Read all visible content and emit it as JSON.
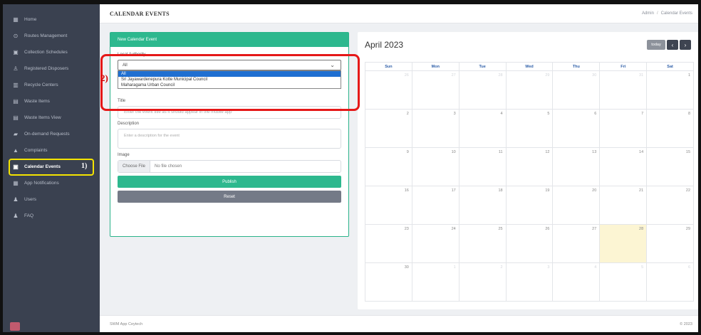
{
  "sidebar": {
    "items": [
      {
        "label": "Home",
        "icon": "grid-icon"
      },
      {
        "label": "Routes Management",
        "icon": "route-icon"
      },
      {
        "label": "Collection Schedules",
        "icon": "calendar-icon"
      },
      {
        "label": "Registered Disposers",
        "icon": "user-icon"
      },
      {
        "label": "Recycle Centers",
        "icon": "building-icon"
      },
      {
        "label": "Waste Items",
        "icon": "trash-icon"
      },
      {
        "label": "Waste Items View",
        "icon": "list-icon"
      },
      {
        "label": "On-demand Requests",
        "icon": "truck-icon"
      },
      {
        "label": "Complaints",
        "icon": "alert-icon"
      },
      {
        "label": "Calendar Events",
        "icon": "calendar-icon"
      },
      {
        "label": "App Notifications",
        "icon": "bell-icon"
      },
      {
        "label": "Users",
        "icon": "users-icon"
      },
      {
        "label": "FAQ",
        "icon": "question-icon"
      }
    ],
    "annotation_1": "1)"
  },
  "header": {
    "title": "CALENDAR EVENTS",
    "breadcrumb": [
      "Admin",
      "Calendar Events"
    ]
  },
  "form": {
    "header": "New Calendar Event",
    "authority_label": "Local Authority",
    "authority_value": "All",
    "authority_options": [
      "All",
      "Sri Jayawardenepura Kotte Municipal Council",
      "Maharagama Urban Council"
    ],
    "title_label": "Title",
    "title_placeholder": "Enter the event title as it should appear in the mobile app",
    "description_label": "Description",
    "description_placeholder": "Enter a description for the event",
    "image_label": "Image",
    "choose_file": "Choose File",
    "no_file": "No file chosen",
    "publish_label": "Publish",
    "reset_label": "Reset",
    "annotation_2": "2)"
  },
  "calendar": {
    "title": "April 2023",
    "today_label": "today",
    "prev_label": "‹",
    "next_label": "›",
    "days": [
      "Sun",
      "Mon",
      "Tue",
      "Wed",
      "Thu",
      "Fri",
      "Sat"
    ],
    "weeks": [
      [
        "26",
        "27",
        "28",
        "29",
        "30",
        "31",
        "1"
      ],
      [
        "2",
        "3",
        "4",
        "5",
        "6",
        "7",
        "8"
      ],
      [
        "9",
        "10",
        "11",
        "12",
        "13",
        "14",
        "15"
      ],
      [
        "16",
        "17",
        "18",
        "19",
        "20",
        "21",
        "22"
      ],
      [
        "23",
        "24",
        "25",
        "26",
        "27",
        "28",
        "29"
      ],
      [
        "30",
        "1",
        "2",
        "3",
        "4",
        "5",
        "6"
      ]
    ],
    "today": "28"
  },
  "footer": {
    "left": "SWM App Ceytech",
    "right": "© 2023"
  }
}
